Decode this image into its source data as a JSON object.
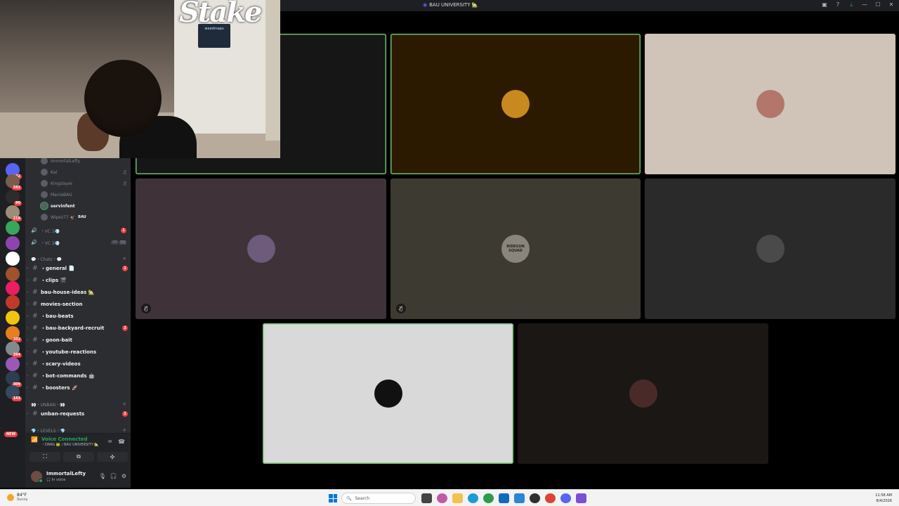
{
  "window": {
    "title": "BAU UNIVERSITY 🏡"
  },
  "servers": [
    {
      "badge": "442",
      "color": "#5865f2"
    },
    {
      "badge": "343",
      "color": "#7a5c4a"
    },
    {
      "badge": "90",
      "color": "#2c2c2c"
    },
    {
      "badge": "218",
      "color": "#9c8c7a"
    },
    {
      "badge": "",
      "color": "#3aa55d"
    },
    {
      "badge": "",
      "color": "#8e44ad"
    },
    {
      "badge": "",
      "color": "#ffffff"
    },
    {
      "badge": "",
      "color": "#a0522d"
    },
    {
      "badge": "",
      "color": "#e91e63"
    },
    {
      "badge": "",
      "color": "#c0392b"
    },
    {
      "badge": "",
      "color": "#f1c40f"
    },
    {
      "badge": "302",
      "color": "#e67e22"
    },
    {
      "badge": "394",
      "color": "#7f8c8d"
    },
    {
      "badge": "",
      "color": "#9b59b6"
    },
    {
      "badge": "309",
      "color": "#2c3e50"
    },
    {
      "badge": "143",
      "color": "#34495e"
    }
  ],
  "new_badge": "NEW",
  "voice_users": [
    {
      "name": "ImmortalLefty",
      "active": false,
      "muted": false,
      "tag": ""
    },
    {
      "name": "Kal",
      "active": false,
      "muted": true,
      "tag": ""
    },
    {
      "name": "Kingslayer",
      "active": false,
      "muted": true,
      "tag": ""
    },
    {
      "name": "ManieBAU",
      "active": false,
      "muted": false,
      "tag": ""
    },
    {
      "name": "servinfent",
      "active": true,
      "muted": false,
      "tag": ""
    },
    {
      "name": "Wipez77 🦅",
      "active": false,
      "muted": false,
      "tag": "BAU"
    }
  ],
  "voice_channels": [
    {
      "name": "・VC 1💨",
      "badge": "1"
    },
    {
      "name": "・VC 2💨",
      "counts": [
        "00",
        "50"
      ]
    }
  ],
  "categories": {
    "chats": "💬・Chats・💬",
    "unban": "👀・UNBAN・👀",
    "levels": "💎・LEVELS・💎"
  },
  "channels": [
    {
      "name": "・general 📄",
      "badge": "1"
    },
    {
      "name": "・clips 🎬",
      "badge": ""
    },
    {
      "name": "bau-house-ideas 🏡",
      "badge": ""
    },
    {
      "name": "movies-section",
      "badge": ""
    },
    {
      "name": "・bau-beats",
      "badge": ""
    },
    {
      "name": "・bau-backyard-recruit",
      "badge": "2"
    },
    {
      "name": "・goon-bait",
      "badge": ""
    },
    {
      "name": "・youtube-reactions",
      "badge": ""
    },
    {
      "name": "・scary-videos",
      "badge": ""
    },
    {
      "name": "・bot-commands 🤖",
      "badge": ""
    },
    {
      "name": "・boosters 🚀",
      "badge": ""
    }
  ],
  "unban_channel": {
    "name": "unban-requests",
    "badge": "1"
  },
  "voice_panel": {
    "status": "Voice Connected",
    "location": "・DRAG 🐸 / BAU UNIVERSITY 🏡"
  },
  "user_panel": {
    "name": "ImmortalLefty",
    "status": "🎧 In voice"
  },
  "webcam": {
    "logo": "Stake",
    "sign": "weedmaps"
  },
  "tiles": [
    {
      "bg": "#161616",
      "speaking": true,
      "avatar": "",
      "muted": false
    },
    {
      "bg": "#2b1900",
      "speaking": true,
      "avatar": "#c8891f",
      "muted": false
    },
    {
      "bg": "#d0c4b8",
      "speaking": false,
      "avatar": "#b2766a",
      "muted": false
    },
    {
      "bg": "#3f3339",
      "speaking": false,
      "avatar": "#6e5a7a",
      "muted": true
    },
    {
      "bg": "#3c3a31",
      "speaking": false,
      "avatar": "#8a857a",
      "muted": true
    },
    {
      "bg": "#2a2a2a",
      "speaking": false,
      "avatar": "#4a4a4a",
      "muted": false
    },
    {
      "bg": "#d9d9d9",
      "speaking": true,
      "avatar": "#111111",
      "muted": false
    },
    {
      "bg": "#1a1715",
      "speaking": false,
      "avatar": "#4a2a28",
      "muted": false
    }
  ],
  "tile_labels": {
    "sticker": "RIDEGUN SQUAD"
  },
  "taskbar": {
    "temp": "84°F",
    "condition": "Sunny",
    "search_placeholder": "Search",
    "time": "11:58 AM",
    "date": "8/4/2026"
  }
}
